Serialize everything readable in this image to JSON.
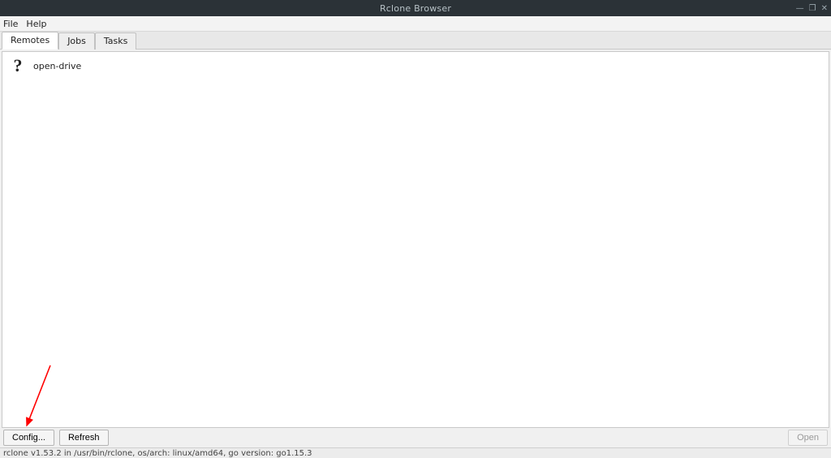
{
  "window": {
    "title": "Rclone Browser",
    "controls": {
      "min": "—",
      "max": "❐",
      "close": "✕"
    }
  },
  "menu": {
    "file": "File",
    "help": "Help"
  },
  "tabs": [
    {
      "label": "Remotes",
      "active": true
    },
    {
      "label": "Jobs",
      "active": false
    },
    {
      "label": "Tasks",
      "active": false
    }
  ],
  "remotes": [
    {
      "icon": "?",
      "name": "open-drive"
    }
  ],
  "buttons": {
    "config": "Config...",
    "refresh": "Refresh",
    "open": "Open"
  },
  "status": "rclone v1.53.2 in /usr/bin/rclone, os/arch: linux/amd64, go version: go1.15.3"
}
